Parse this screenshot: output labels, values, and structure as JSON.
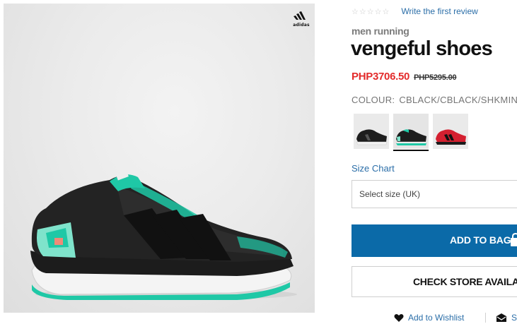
{
  "gallery": {
    "brand_text": "adidas"
  },
  "rating": {
    "stars": "☆☆☆☆☆",
    "review_link": "Write the first review"
  },
  "product": {
    "category": "men running",
    "title": "vengeful shoes",
    "price_sale": "PHP3706.50",
    "price_original": "PHP5295.00",
    "colour_label": "COLOUR:",
    "colour_value": "CBLACK/CBLACK/SHKMIN (AQ"
  },
  "swatches": [
    {
      "name": "black-white",
      "accent": "#e8e8e8",
      "selected": false
    },
    {
      "name": "black-mint",
      "accent": "#1fc8a6",
      "selected": true
    },
    {
      "name": "red-black",
      "accent": "#d42030",
      "selected": false
    }
  ],
  "size": {
    "chart_link": "Size Chart",
    "select_placeholder": "Select size (UK)"
  },
  "actions": {
    "add_to_bag": "ADD TO BAG",
    "check_store": "CHECK STORE AVAILAB",
    "wishlist": "Add to Wishlist",
    "share": "S"
  },
  "colors": {
    "accent_blue": "#0b6aa8",
    "sale_red": "#e32b2b",
    "link_blue": "#2b6ea8",
    "shoe_mint": "#1fc8a6"
  },
  "icons": {
    "brand_logo": "adidas-logo-icon",
    "bag": "shopping-bag-icon",
    "heart": "heart-icon",
    "share": "envelope-share-icon"
  }
}
